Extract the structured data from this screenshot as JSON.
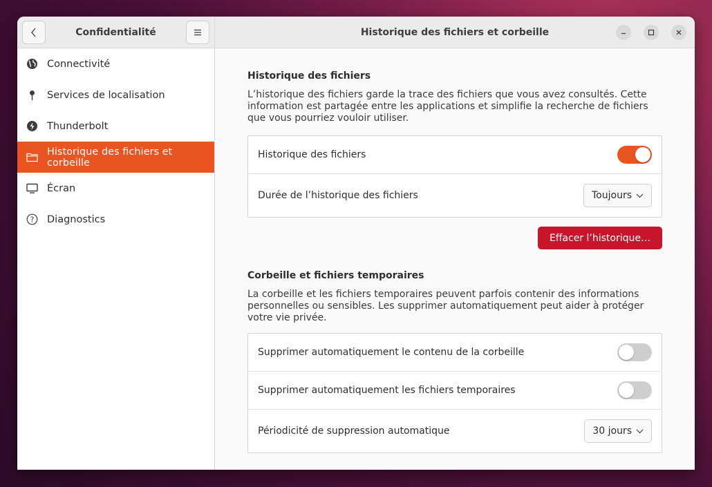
{
  "sidebar": {
    "title": "Confidentialité",
    "items": [
      {
        "label": "Connectivité",
        "icon": "globe-icon",
        "active": false
      },
      {
        "label": "Services de localisation",
        "icon": "location-pin-icon",
        "active": false
      },
      {
        "label": "Thunderbolt",
        "icon": "thunderbolt-icon",
        "active": false
      },
      {
        "label": "Historique des fichiers et corbeille",
        "icon": "folder-icon",
        "active": true
      },
      {
        "label": "Écran",
        "icon": "monitor-icon",
        "active": false
      },
      {
        "label": "Diagnostics",
        "icon": "help-icon",
        "active": false
      }
    ]
  },
  "main": {
    "title": "Historique des fichiers et corbeille",
    "history": {
      "title": "Historique des fichiers",
      "description": "L’historique des fichiers garde la trace des fichiers que vous avez consultés. Cette information est partagée entre les applications et simplifie la recherche de fichiers que vous pourriez vouloir utiliser.",
      "toggle_label": "Historique des fichiers",
      "toggle_on": true,
      "duration_label": "Durée de l’historique des fichiers",
      "duration_value": "Toujours",
      "clear_button": "Effacer l’historique…"
    },
    "trash": {
      "title": "Corbeille et fichiers temporaires",
      "description": "La corbeille et les fichiers temporaires peuvent parfois contenir des informations personnelles ou sensibles. Les supprimer automatiquement peut aider à protéger votre vie privée.",
      "auto_trash_label": "Supprimer automatiquement le contenu de la corbeille",
      "auto_trash_on": false,
      "auto_temp_label": "Supprimer automatiquement les fichiers temporaires",
      "auto_temp_on": false,
      "period_label": "Périodicité de suppression automatique",
      "period_value": "30 jours"
    }
  },
  "colors": {
    "accent": "#e95420",
    "danger": "#c7162b"
  }
}
